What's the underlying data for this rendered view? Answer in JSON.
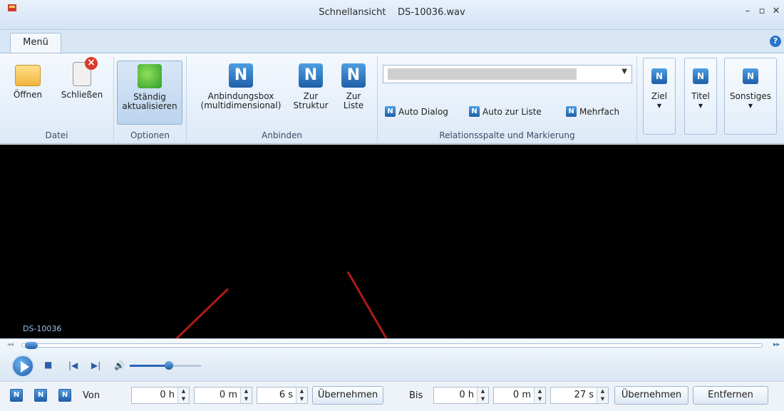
{
  "window": {
    "title": "Schnellansicht",
    "filename": "DS-10036.wav",
    "controls": [
      "minimize-icon",
      "maximize-icon",
      "close-icon"
    ]
  },
  "ribbon": {
    "tab": "Menü",
    "groups": {
      "datei": {
        "label": "Datei",
        "open": "Öffnen",
        "close": "Schließen"
      },
      "optionen": {
        "label": "Optionen",
        "refresh_line1": "Ständig",
        "refresh_line2": "aktualisieren"
      },
      "anbinden": {
        "label": "Anbinden",
        "box_line1": "Anbindungsbox",
        "box_line2": "(multidimensional)",
        "struktur_line1": "Zur",
        "struktur_line2": "Struktur",
        "liste_line1": "Zur",
        "liste_line2": "Liste"
      },
      "relation": {
        "label": "Relationsspalte und Markierung",
        "combo_value": "",
        "auto_dialog": "Auto Dialog",
        "auto_liste": "Auto zur Liste",
        "mehrfach": "Mehrfach"
      },
      "ziel": {
        "label": "Ziel"
      },
      "titel": {
        "label": "Titel"
      },
      "sonstiges": {
        "label": "Sonstiges"
      }
    }
  },
  "media": {
    "caption": "DS-10036",
    "volume_fraction": 0.55,
    "seek_fraction": 0.0
  },
  "bottom": {
    "von_label": "Von",
    "von": {
      "h": "0 h",
      "m": "0 m",
      "s": "6 s"
    },
    "bis_label": "Bis",
    "bis": {
      "h": "0 h",
      "m": "0 m",
      "s": "27 s"
    },
    "apply_label": "Übernehmen",
    "remove_label": "Entfernen"
  },
  "colors": {
    "accent": "#1f5fa8",
    "annotation_arrow": "#b0191a",
    "video_bg": "#000000"
  }
}
